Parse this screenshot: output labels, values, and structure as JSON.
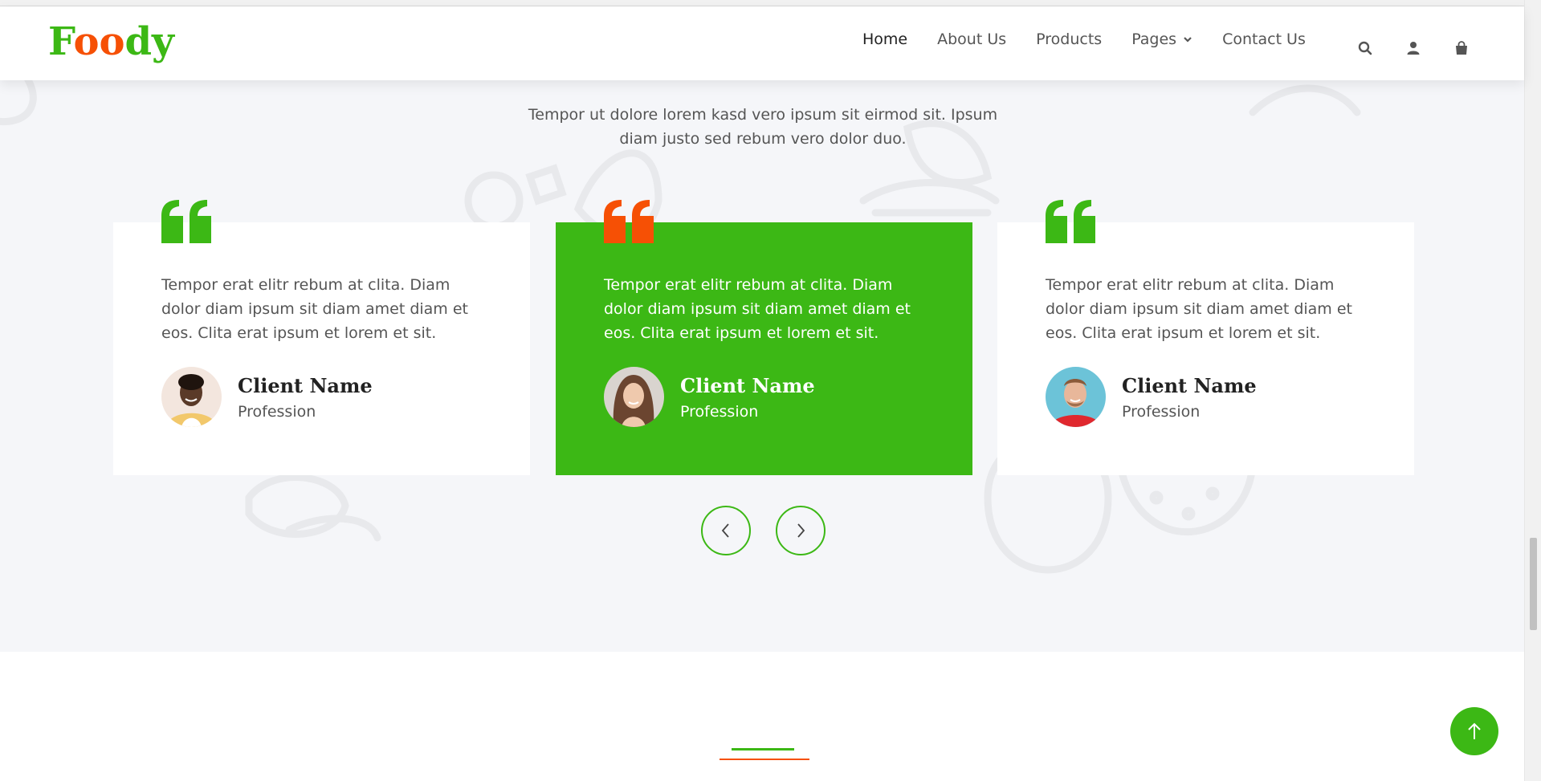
{
  "brand": {
    "logo_part1": "F",
    "logo_part2": "oo",
    "logo_part3": "dy"
  },
  "nav": {
    "items": [
      {
        "label": "Home"
      },
      {
        "label": "About Us"
      },
      {
        "label": "Products"
      },
      {
        "label": "Pages"
      },
      {
        "label": "Contact Us"
      }
    ],
    "icons": [
      "search-icon",
      "user-icon",
      "shopping-bag-icon"
    ]
  },
  "testimonial": {
    "intro": "Tempor ut dolore lorem kasd vero ipsum sit eirmod sit. Ipsum diam justo sed rebum vero dolor duo.",
    "cards": [
      {
        "text": "Tempor erat elitr rebum at clita. Diam dolor diam ipsum sit diam amet diam et eos. Clita erat ipsum et lorem et sit.",
        "name": "Client Name",
        "profession": "Profession"
      },
      {
        "text": "Tempor erat elitr rebum at clita. Diam dolor diam ipsum sit diam amet diam et eos. Clita erat ipsum et lorem et sit.",
        "name": "Client Name",
        "profession": "Profession"
      },
      {
        "text": "Tempor erat elitr rebum at clita. Diam dolor diam ipsum sit diam amet diam et eos. Clita erat ipsum et lorem et sit.",
        "name": "Client Name",
        "profession": "Profession"
      }
    ]
  },
  "colors": {
    "primary": "#3cb815",
    "secondary": "#f65005",
    "section_bg": "#f5f6f9"
  }
}
